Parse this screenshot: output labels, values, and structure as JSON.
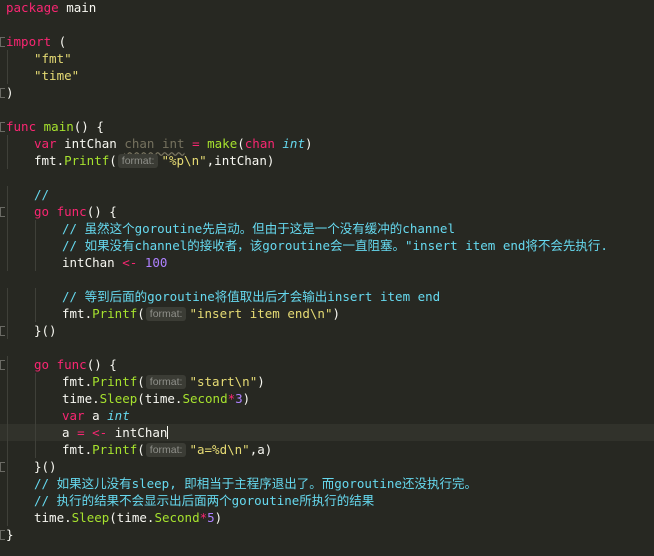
{
  "editor": {
    "theme_colors": {
      "background": "#272822",
      "keyword": "#f92672",
      "string": "#e6db74",
      "function": "#a6e22e",
      "type": "#66d9ef",
      "number": "#ae81ff",
      "comment": "#66d9ef",
      "hint": "#75715e"
    },
    "lines": [
      {
        "fold": false,
        "tokens": [
          {
            "k": "kw",
            "t": "package"
          },
          {
            "k": "pl",
            "t": " main"
          }
        ]
      },
      {
        "fold": false,
        "tokens": []
      },
      {
        "fold": true,
        "tokens": [
          {
            "k": "kw",
            "t": "import"
          },
          {
            "k": "pl",
            "t": " ("
          }
        ]
      },
      {
        "fold": false,
        "indent": 1,
        "tokens": [
          {
            "k": "str",
            "t": "\"fmt\""
          }
        ]
      },
      {
        "fold": false,
        "indent": 1,
        "tokens": [
          {
            "k": "str",
            "t": "\"time\""
          }
        ]
      },
      {
        "fold": true,
        "tokens": [
          {
            "k": "pl",
            "t": ")"
          }
        ]
      },
      {
        "fold": false,
        "tokens": []
      },
      {
        "fold": true,
        "tokens": [
          {
            "k": "kw",
            "t": "func"
          },
          {
            "k": "pl",
            "t": " "
          },
          {
            "k": "fn",
            "t": "main"
          },
          {
            "k": "pl",
            "t": "() {"
          }
        ]
      },
      {
        "fold": false,
        "indent": 1,
        "tokens": [
          {
            "k": "kw",
            "t": "var"
          },
          {
            "k": "pl",
            "t": " intChan "
          },
          {
            "k": "hint",
            "t": "chan int"
          },
          {
            "k": "pl",
            "t": " "
          },
          {
            "k": "op",
            "t": "="
          },
          {
            "k": "pl",
            "t": " "
          },
          {
            "k": "fn",
            "t": "make"
          },
          {
            "k": "pl",
            "t": "("
          },
          {
            "k": "kw",
            "t": "chan"
          },
          {
            "k": "pl",
            "t": " "
          },
          {
            "k": "type",
            "t": "int"
          },
          {
            "k": "pl",
            "t": ")"
          }
        ]
      },
      {
        "fold": false,
        "indent": 1,
        "tokens": [
          {
            "k": "pl",
            "t": "fmt."
          },
          {
            "k": "fn",
            "t": "Printf"
          },
          {
            "k": "pl",
            "t": "("
          },
          {
            "k": "chip",
            "t": "format:"
          },
          {
            "k": "str",
            "t": "\"%p\\n\""
          },
          {
            "k": "pl",
            "t": ",intChan)"
          }
        ]
      },
      {
        "fold": false,
        "tokens": []
      },
      {
        "fold": false,
        "indent": 1,
        "tokens": [
          {
            "k": "cm",
            "t": "//"
          }
        ]
      },
      {
        "fold": true,
        "indent": 1,
        "tokens": [
          {
            "k": "kw",
            "t": "go"
          },
          {
            "k": "pl",
            "t": " "
          },
          {
            "k": "kw",
            "t": "func"
          },
          {
            "k": "pl",
            "t": "() {"
          }
        ]
      },
      {
        "fold": false,
        "indent": 2,
        "tokens": [
          {
            "k": "cm",
            "t": "// 虽然这个goroutine先启动。但由于这是一个没有缓冲的channel"
          }
        ]
      },
      {
        "fold": false,
        "indent": 2,
        "tokens": [
          {
            "k": "cm",
            "t": "// 如果没有channel的接收者，该goroutine会一直阻塞。\"insert item end将不会先执行."
          }
        ]
      },
      {
        "fold": false,
        "indent": 2,
        "tokens": [
          {
            "k": "pl",
            "t": "intChan "
          },
          {
            "k": "op",
            "t": "<-"
          },
          {
            "k": "pl",
            "t": " "
          },
          {
            "k": "num",
            "t": "100"
          }
        ]
      },
      {
        "fold": false,
        "tokens": []
      },
      {
        "fold": false,
        "indent": 2,
        "tokens": [
          {
            "k": "cm",
            "t": "// 等到后面的goroutine将值取出后才会输出insert item end"
          }
        ]
      },
      {
        "fold": false,
        "indent": 2,
        "tokens": [
          {
            "k": "pl",
            "t": "fmt."
          },
          {
            "k": "fn",
            "t": "Printf"
          },
          {
            "k": "pl",
            "t": "("
          },
          {
            "k": "chip",
            "t": "format:"
          },
          {
            "k": "str",
            "t": "\"insert item end\\n\""
          },
          {
            "k": "pl",
            "t": ")"
          }
        ]
      },
      {
        "fold": true,
        "indent": 1,
        "tokens": [
          {
            "k": "pl",
            "t": "}()"
          }
        ]
      },
      {
        "fold": false,
        "tokens": []
      },
      {
        "fold": true,
        "indent": 1,
        "tokens": [
          {
            "k": "kw",
            "t": "go"
          },
          {
            "k": "pl",
            "t": " "
          },
          {
            "k": "kw",
            "t": "func"
          },
          {
            "k": "pl",
            "t": "() {"
          }
        ]
      },
      {
        "fold": false,
        "indent": 2,
        "tokens": [
          {
            "k": "pl",
            "t": "fmt."
          },
          {
            "k": "fn",
            "t": "Printf"
          },
          {
            "k": "pl",
            "t": "("
          },
          {
            "k": "chip",
            "t": "format:"
          },
          {
            "k": "str",
            "t": "\"start\\n\""
          },
          {
            "k": "pl",
            "t": ")"
          }
        ]
      },
      {
        "fold": false,
        "indent": 2,
        "tokens": [
          {
            "k": "pl",
            "t": "time."
          },
          {
            "k": "fn",
            "t": "Sleep"
          },
          {
            "k": "pl",
            "t": "(time."
          },
          {
            "k": "fn",
            "t": "Second"
          },
          {
            "k": "op",
            "t": "*"
          },
          {
            "k": "num",
            "t": "3"
          },
          {
            "k": "pl",
            "t": ")"
          }
        ]
      },
      {
        "fold": false,
        "indent": 2,
        "tokens": [
          {
            "k": "kw",
            "t": "var"
          },
          {
            "k": "pl",
            "t": " a "
          },
          {
            "k": "type",
            "t": "int"
          }
        ]
      },
      {
        "fold": false,
        "indent": 2,
        "current": true,
        "tokens": [
          {
            "k": "pl",
            "t": "a "
          },
          {
            "k": "op",
            "t": "="
          },
          {
            "k": "pl",
            "t": " "
          },
          {
            "k": "op",
            "t": "<-"
          },
          {
            "k": "pl",
            "t": " intChan"
          }
        ]
      },
      {
        "fold": false,
        "indent": 2,
        "tokens": [
          {
            "k": "pl",
            "t": "fmt."
          },
          {
            "k": "fn",
            "t": "Printf"
          },
          {
            "k": "pl",
            "t": "("
          },
          {
            "k": "chip",
            "t": "format:"
          },
          {
            "k": "str",
            "t": "\"a=%d\\n\""
          },
          {
            "k": "pl",
            "t": ",a)"
          }
        ]
      },
      {
        "fold": true,
        "indent": 1,
        "tokens": [
          {
            "k": "pl",
            "t": "}()"
          }
        ]
      },
      {
        "fold": false,
        "indent": 1,
        "tokens": [
          {
            "k": "cm",
            "t": "// 如果这儿没有sleep, 即相当于主程序退出了。而goroutine还没执行完。"
          }
        ]
      },
      {
        "fold": false,
        "indent": 1,
        "tokens": [
          {
            "k": "cm",
            "t": "// 执行的结果不会显示出后面两个goroutine所执行的结果"
          }
        ]
      },
      {
        "fold": false,
        "indent": 1,
        "tokens": [
          {
            "k": "pl",
            "t": "time."
          },
          {
            "k": "fn",
            "t": "Sleep"
          },
          {
            "k": "pl",
            "t": "(time."
          },
          {
            "k": "fn",
            "t": "Second"
          },
          {
            "k": "op",
            "t": "*"
          },
          {
            "k": "num",
            "t": "5"
          },
          {
            "k": "pl",
            "t": ")"
          }
        ]
      },
      {
        "fold": true,
        "tokens": [
          {
            "k": "pl",
            "t": "}"
          }
        ]
      }
    ]
  }
}
